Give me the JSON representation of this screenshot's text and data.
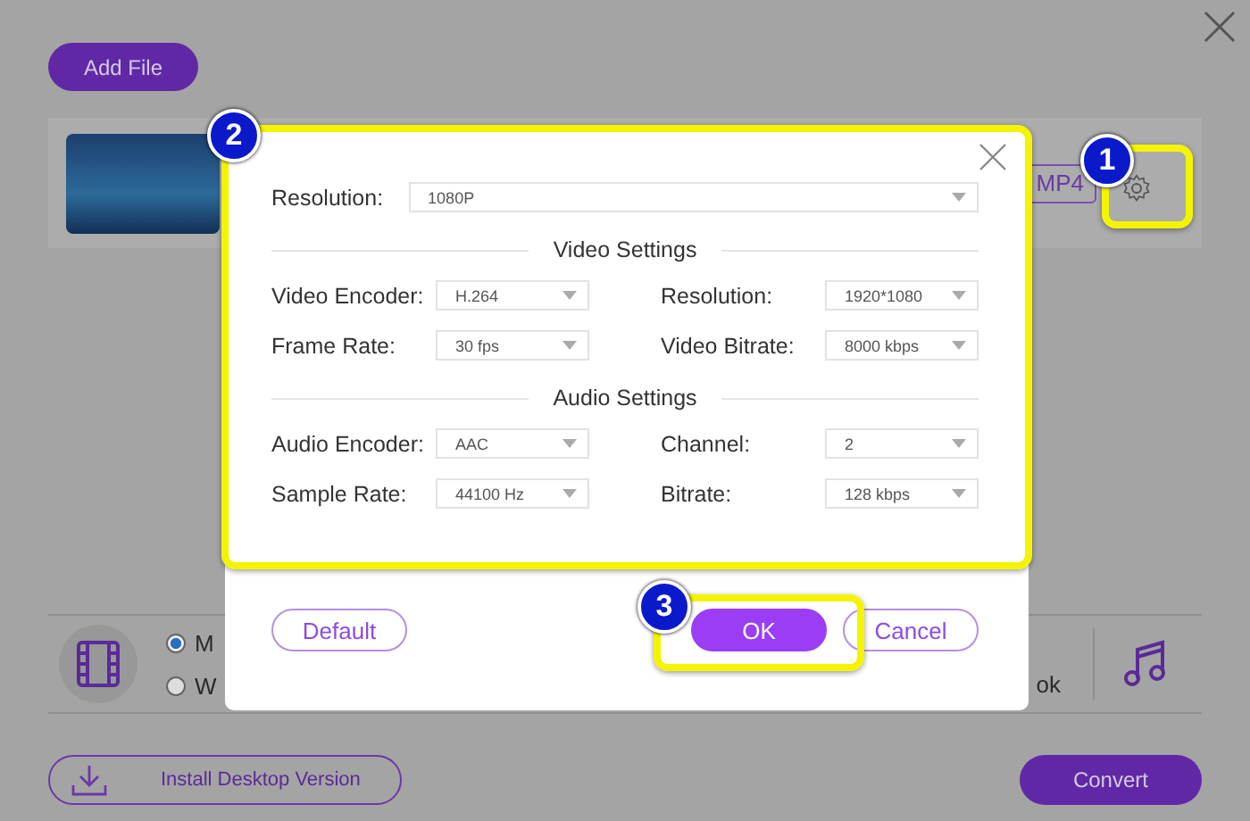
{
  "page": {
    "add_file_button": "Add File",
    "file_row": {
      "format_button": "MP4"
    },
    "output": {
      "formats": [
        {
          "label": "M",
          "selected": true
        },
        {
          "label": "W",
          "selected": false
        }
      ],
      "partial_label": "ok"
    },
    "install_button": "Install Desktop Version",
    "convert_button": "Convert"
  },
  "dialog": {
    "resolution": {
      "label": "Resolution:",
      "value": "1080P"
    },
    "sections": [
      {
        "title": "Video Settings",
        "fields": [
          {
            "label": "Video Encoder:",
            "value": "H.264"
          },
          {
            "label": "Resolution:",
            "value": "1920*1080"
          },
          {
            "label": "Frame Rate:",
            "value": "30 fps"
          },
          {
            "label": "Video Bitrate:",
            "value": "8000 kbps"
          }
        ]
      },
      {
        "title": "Audio Settings",
        "fields": [
          {
            "label": "Audio Encoder:",
            "value": "AAC"
          },
          {
            "label": "Channel:",
            "value": "2"
          },
          {
            "label": "Sample Rate:",
            "value": "44100 Hz"
          },
          {
            "label": "Bitrate:",
            "value": "128 kbps"
          }
        ]
      }
    ],
    "buttons": [
      {
        "label": "Default",
        "kind": "outline"
      },
      {
        "label": "OK",
        "kind": "primary"
      },
      {
        "label": "Cancel",
        "kind": "outline"
      }
    ]
  },
  "callouts": [
    "1",
    "2",
    "3"
  ]
}
